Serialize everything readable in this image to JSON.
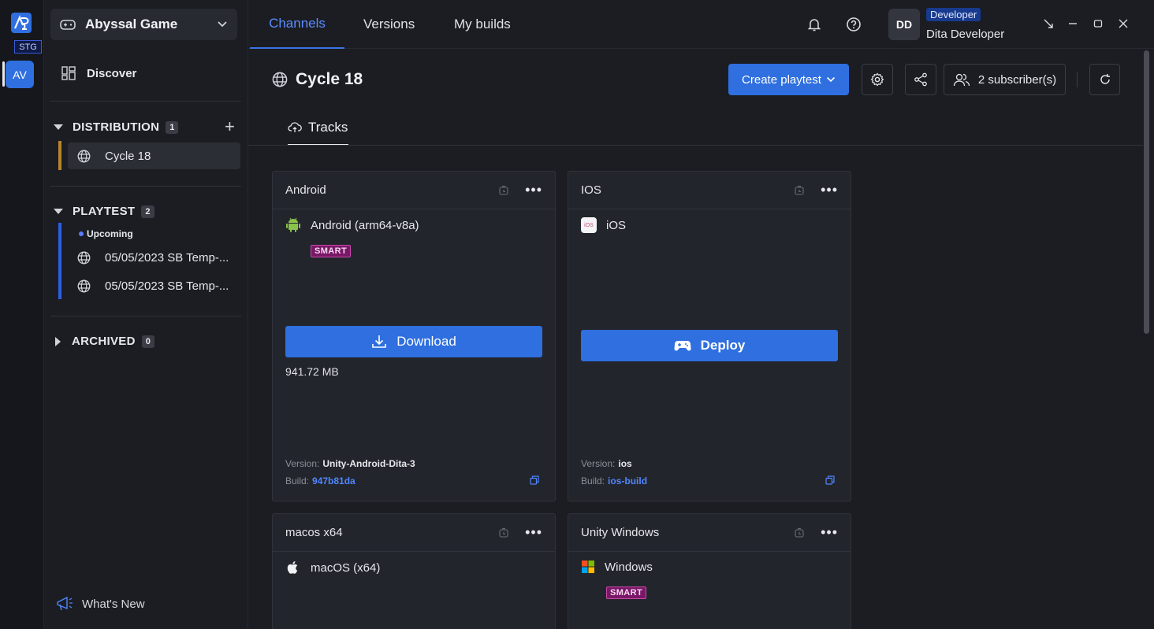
{
  "rail": {
    "env_badge": "STG",
    "workspace_initials": "AV"
  },
  "sidebar": {
    "game_name": "Abyssal Game",
    "discover_label": "Discover",
    "distribution": {
      "label": "DISTRIBUTION",
      "count": "1",
      "items": [
        {
          "label": "Cycle 18"
        }
      ]
    },
    "playtest": {
      "label": "PLAYTEST",
      "count": "2",
      "group_label": "Upcoming",
      "items": [
        {
          "label": "05/05/2023 SB Temp-..."
        },
        {
          "label": "05/05/2023 SB Temp-..."
        }
      ]
    },
    "archived": {
      "label": "ARCHIVED",
      "count": "0"
    },
    "whats_new": "What's New"
  },
  "header": {
    "tabs": [
      {
        "label": "Channels"
      },
      {
        "label": "Versions"
      },
      {
        "label": "My builds"
      }
    ],
    "user": {
      "initials": "DD",
      "role": "Developer",
      "name": "Dita Developer"
    }
  },
  "main": {
    "title": "Cycle 18",
    "create_playtest": "Create playtest",
    "subscribers": "2 subscriber(s)",
    "subtab": "Tracks",
    "cards": [
      {
        "title": "Android",
        "platform": "Android (arm64-v8a)",
        "badge": "SMART",
        "button": "Download",
        "size": "941.72 MB",
        "version_label": "Version:",
        "version": "Unity-Android-Dita-3",
        "build_label": "Build:",
        "build": "947b81da"
      },
      {
        "title": "IOS",
        "platform": "iOS",
        "platform_icon_text": "iOS",
        "button": "Deploy",
        "version_label": "Version:",
        "version": "ios",
        "build_label": "Build:",
        "build": "ios-build"
      },
      {
        "title": "macos x64",
        "platform": "macOS (x64)"
      },
      {
        "title": "Unity Windows",
        "platform": "Windows",
        "badge": "SMART"
      }
    ]
  },
  "colors": {
    "accent": "#2f6fdf",
    "background": "#1b1d23",
    "card": "#23252c",
    "smart_badge": "#7a1868",
    "distribution_bar": "#b7852d",
    "playtest_bar": "#2f5fe0"
  }
}
